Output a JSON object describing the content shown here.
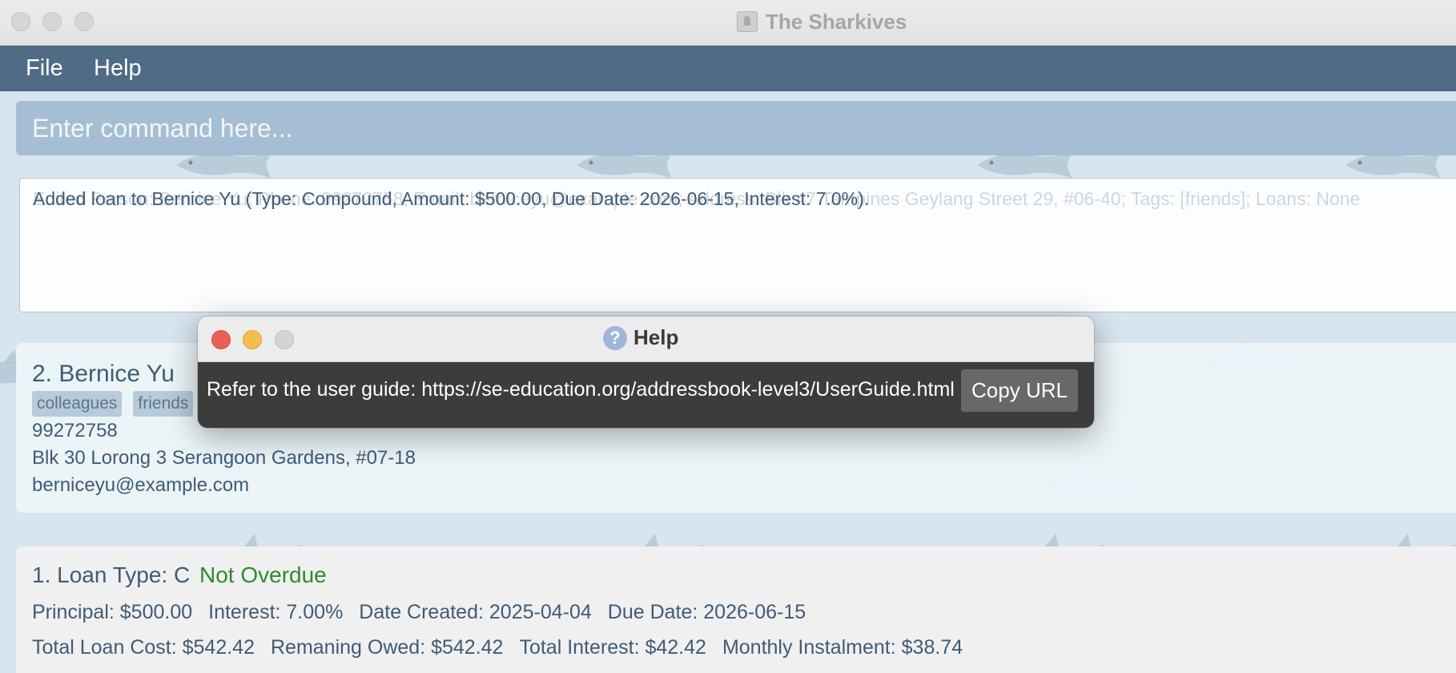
{
  "window": {
    "title": "The Sharkives",
    "app_icon": "app-icon",
    "traffic_color": "#d6d6d6"
  },
  "menu": {
    "file_label": "File",
    "help_label": "Help"
  },
  "command_box": {
    "placeholder": "Enter command here...",
    "value": ""
  },
  "result_display": {
    "text": "Added loan to Bernice Yu (Type: Compound, Amount: $500.00, Due Date: 2026-06-15, Interest: 7.0%).",
    "ghost_text": "Edited Person: Bernice Yu; Phone: 99272758; Email: berniceyu@example.com; Address: Blk 47 Tampines Geylang Street 29, #06-40; Tags: [friends]; Loans: None"
  },
  "person_card": {
    "index_name": "2.  Bernice Yu",
    "tags": [
      "colleagues",
      "friends"
    ],
    "phone": "99272758",
    "address": "Blk 30 Lorong 3 Serangoon Gardens, #07-18",
    "email": "berniceyu@example.com"
  },
  "loan_card": {
    "title": "1. Loan Type: C",
    "status": "Not Overdue",
    "status_color": "#2e8b2e",
    "principal": "Principal: $500.00",
    "interest": "Interest: 7.00%",
    "date_created": "Date Created: 2025-04-04",
    "due_date": "Due Date: 2026-06-15",
    "total_cost": "Total Loan Cost: $542.42",
    "remaining": "Remaning Owed: $542.42",
    "total_interest": "Total Interest: $42.42",
    "monthly": "Monthly Instalment: $38.74"
  },
  "help_dialog": {
    "title": "Help",
    "icon": "question-icon",
    "message": "Refer to the user guide: https://se-education.org/addressbook-level3/UserGuide.html",
    "copy_button": "Copy URL",
    "close_color": "#ec5f57",
    "minimize_color": "#f5bd4f",
    "maximize_color": "#d4d4d4"
  },
  "colors": {
    "menubar": "#4f6b85",
    "command_box": "#a6bed4",
    "text_primary": "#3f5b76"
  }
}
